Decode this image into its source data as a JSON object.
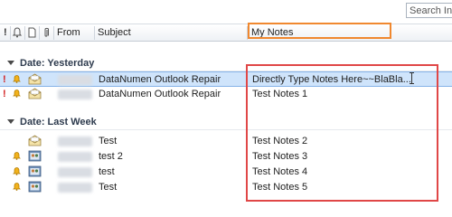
{
  "search": {
    "value": "Search Inb"
  },
  "columns": {
    "importance_icon": "exclamation-icon",
    "reminder_icon": "bell-icon",
    "type_icon": "document-icon",
    "attachment_icon": "paperclip-icon",
    "from": "From",
    "subject": "Subject",
    "my_notes": "My Notes"
  },
  "groups": [
    {
      "label": "Date: Yesterday",
      "rows": [
        {
          "important": true,
          "reminder": true,
          "icon": "envelope-open-icon",
          "subject": "DataNumen Outlook Repair",
          "notes": "Directly Type Notes Here~~BlaBla...",
          "selected": true
        },
        {
          "important": true,
          "reminder": true,
          "icon": "envelope-open-icon",
          "subject": "DataNumen Outlook Repair",
          "notes": "Test Notes 1",
          "selected": false
        }
      ]
    },
    {
      "label": "Date: Last Week",
      "rows": [
        {
          "important": false,
          "reminder": false,
          "icon": "envelope-open-icon",
          "subject": "Test",
          "notes": "Test Notes 2",
          "selected": false
        },
        {
          "important": false,
          "reminder": true,
          "icon": "meeting-icon",
          "subject": "test 2",
          "notes": "Test Notes 3",
          "selected": false
        },
        {
          "important": false,
          "reminder": true,
          "icon": "meeting-icon",
          "subject": "test",
          "notes": "Test Notes 4",
          "selected": false
        },
        {
          "important": false,
          "reminder": true,
          "icon": "meeting-icon",
          "subject": "Test",
          "notes": "Test Notes 5",
          "selected": false
        }
      ]
    }
  ],
  "colors": {
    "highlight_header": "#f0882f",
    "highlight_notes": "#e04747",
    "selection": "#cfe4fb",
    "importance": "#d21f1f"
  }
}
